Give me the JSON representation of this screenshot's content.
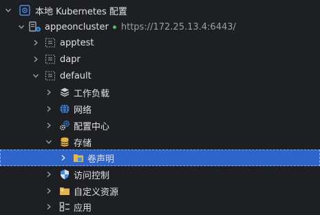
{
  "tree": {
    "root": {
      "label": "本地 Kubernetes 配置"
    },
    "cluster": {
      "name": "appeoncluster",
      "url": "https://172.25.13.4:6443/",
      "status_color": "#5fb865"
    },
    "namespaces": [
      {
        "label": "apptest"
      },
      {
        "label": "dapr"
      },
      {
        "label": "default"
      }
    ],
    "default_children": [
      {
        "label": "工作负载",
        "icon": "workloads-icon"
      },
      {
        "label": "网络",
        "icon": "globe-icon"
      },
      {
        "label": "配置中心",
        "icon": "gears-icon"
      },
      {
        "label": "存储",
        "icon": "database-icon"
      },
      {
        "label": "卷声明",
        "icon": "volume-claim-folder-icon",
        "selected": true
      },
      {
        "label": "访问控制",
        "icon": "shield-icon"
      },
      {
        "label": "自定义资源",
        "icon": "folder-icon"
      },
      {
        "label": "应用",
        "icon": "apps-icon"
      }
    ]
  },
  "colors": {
    "background": "#1e1f22",
    "selection": "#2f65ca",
    "text": "#dfe1e5",
    "muted": "#9a9ea6",
    "accent_blue": "#3d8ee6"
  }
}
